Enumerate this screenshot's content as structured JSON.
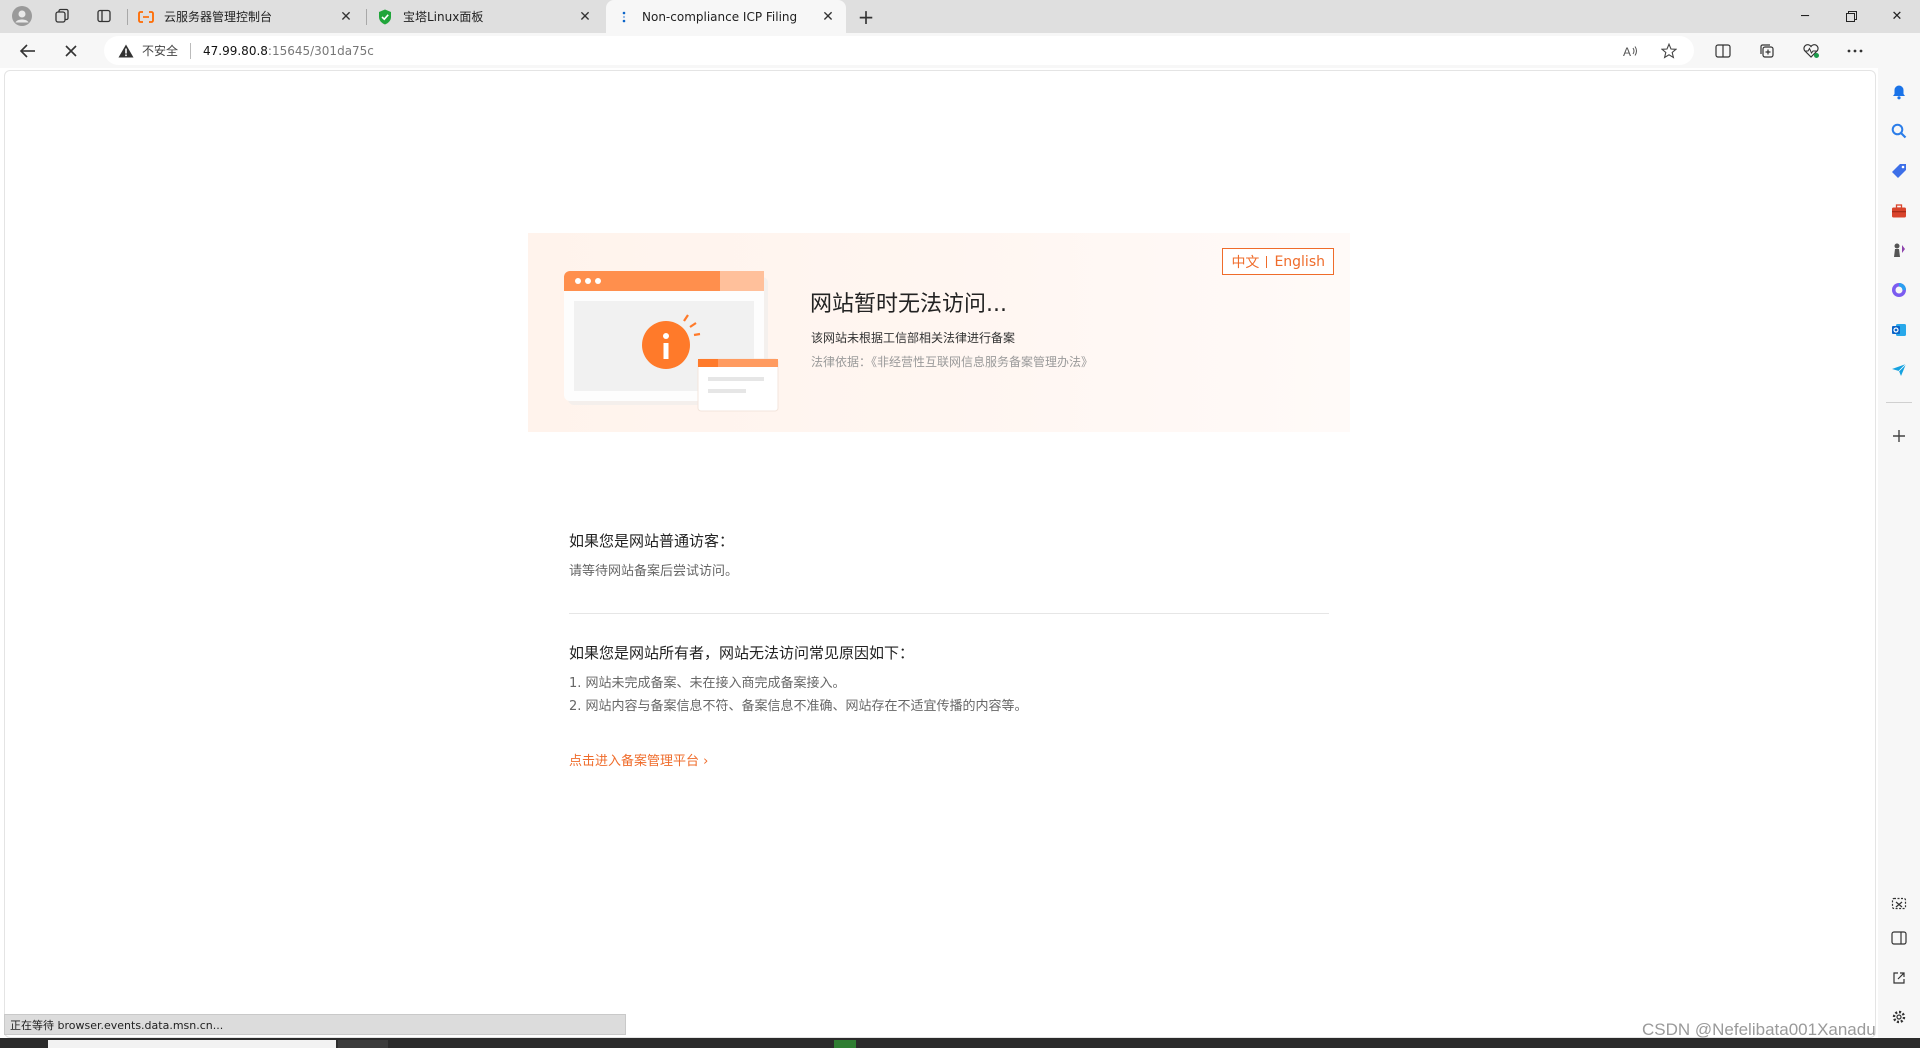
{
  "browser": {
    "tabs": [
      {
        "title": "云服务器管理控制台",
        "favicon": "aliyun-icon",
        "active": false
      },
      {
        "title": "宝塔Linux面板",
        "favicon": "baota-shield-icon",
        "active": false
      },
      {
        "title": "Non-compliance ICP Filing",
        "favicon": "loading-icon",
        "active": true
      }
    ],
    "address": {
      "security_label": "不安全",
      "host": "47.99.80.8",
      "path": ":15645/301da75c"
    },
    "status_text": "正在等待 browser.events.data.msn.cn..."
  },
  "page": {
    "lang_toggle": {
      "zh": "中文",
      "en": "English"
    },
    "title": "网站暂时无法访问...",
    "description": "该网站未根据工信部相关法律进行备案",
    "law_basis": "法律依据：《非经营性互联网信息服务备案管理办法》",
    "visitor": {
      "heading": "如果您是网站普通访客：",
      "text": "请等待网站备案后尝试访问。"
    },
    "owner": {
      "heading": "如果您是网站所有者，网站无法访问常见原因如下：",
      "reasons": [
        "1. 网站未完成备案、未在接入商完成备案接入。",
        "2. 网站内容与备案信息不符、备案信息不准确、网站存在不适宜传播的内容等。"
      ]
    },
    "cta": "点击进入备案管理平台 ›"
  },
  "watermark": "CSDN @Nefelibata001Xanadu",
  "colors": {
    "accent": "#ef6c2b",
    "hero_bg": "#fff4ee"
  }
}
